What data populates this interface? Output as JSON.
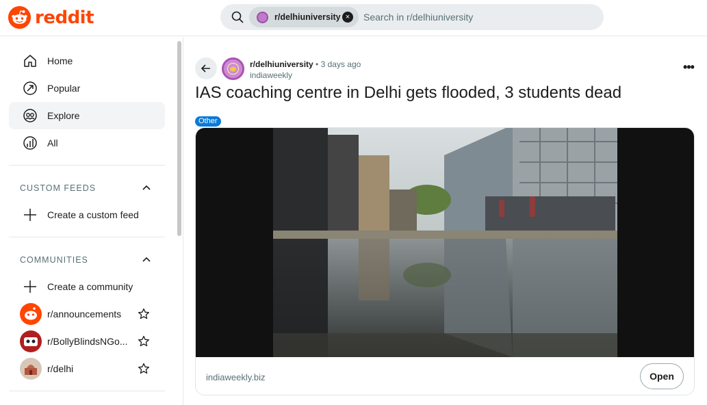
{
  "header": {
    "logo_text": "reddit",
    "search": {
      "chip_label": "r/delhiuniversity",
      "placeholder": "Search in r/delhiuniversity"
    }
  },
  "sidebar": {
    "nav": [
      {
        "label": "Home",
        "icon": "home-icon"
      },
      {
        "label": "Popular",
        "icon": "popular-icon"
      },
      {
        "label": "Explore",
        "icon": "explore-icon",
        "active": true
      },
      {
        "label": "All",
        "icon": "all-icon"
      }
    ],
    "custom_feeds": {
      "title": "CUSTOM FEEDS",
      "create_label": "Create a custom feed"
    },
    "communities": {
      "title": "COMMUNITIES",
      "create_label": "Create a community",
      "items": [
        {
          "name": "r/announcements",
          "avatar_color": "#ff4500"
        },
        {
          "name": "r/BollyBlindsNGo...",
          "avatar_color": "#b11f1f"
        },
        {
          "name": "r/delhi",
          "avatar_color": "#c79a78"
        }
      ]
    }
  },
  "post": {
    "subreddit": "r/delhiuniversity",
    "time_ago": "• 3 days ago",
    "author": "indiaweekly",
    "title": "IAS coaching centre in Delhi gets flooded, 3 students dead",
    "flair": "Other",
    "link_domain": "indiaweekly.biz",
    "open_label": "Open"
  },
  "colors": {
    "brand": "#ff4500",
    "flair": "#0a7ad6"
  }
}
